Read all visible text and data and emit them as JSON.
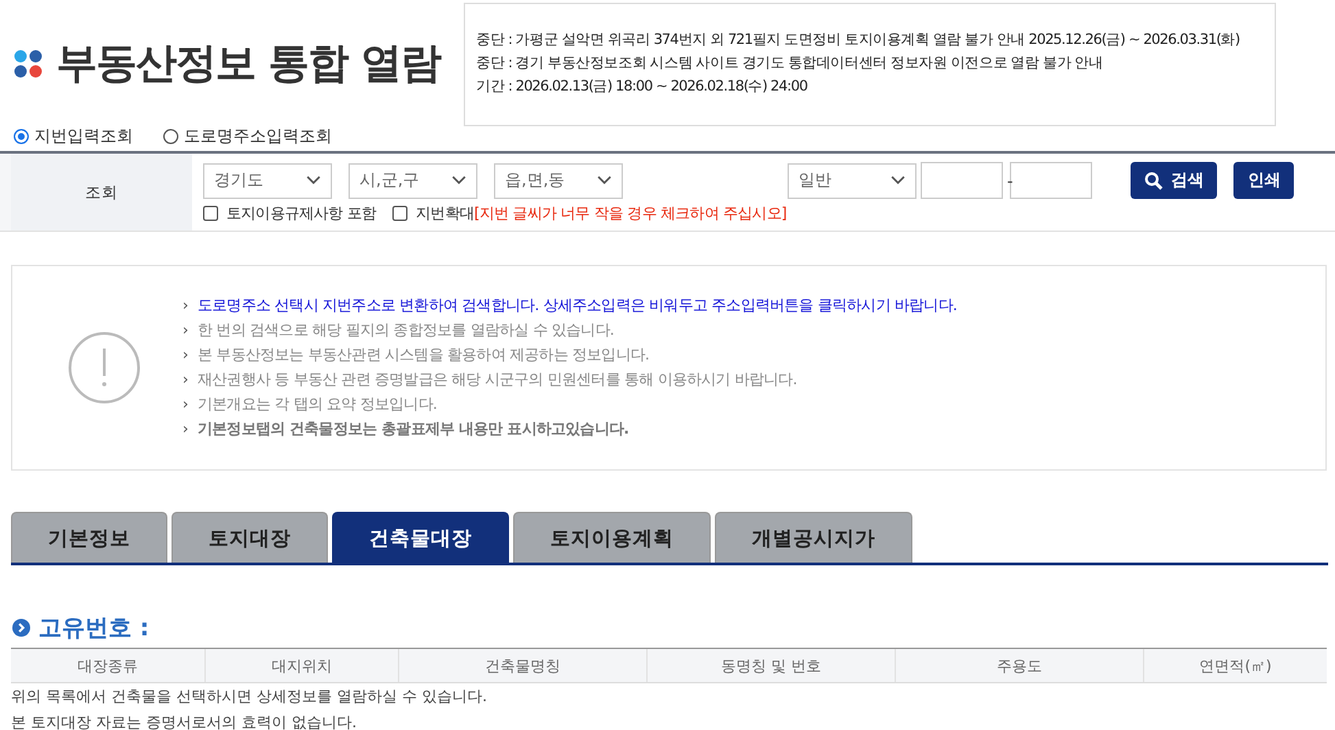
{
  "header": {
    "title": "부동산정보 통합 열람"
  },
  "notices": [
    "중단 : 가평군 설악면 위곡리 374번지 외 721필지 도면정비 토지이용계획 열람 불가 안내 2025.12.26(금) ~ 2026.03.31(화)",
    "중단 : 경기 부동산정보조회 시스템 사이트 경기도 통합데이터센터 정보자원 이전으로 열람 불가 안내",
    "기간 : 2026.02.13(금) 18:00 ~ 2026.02.18(수) 24:00"
  ],
  "input_modes": [
    {
      "label": "지번입력조회",
      "selected": true
    },
    {
      "label": "도로명주소입력조회",
      "selected": false
    }
  ],
  "search": {
    "label": "조회",
    "selects": [
      "경기도",
      "시,군,구",
      "읍,면,동",
      "일반"
    ],
    "separator": "-",
    "options": [
      {
        "label": "토지이용규제사항 포함",
        "checked": false
      },
      {
        "label": "지번확대",
        "checked": false,
        "note": "[지번 글씨가 너무 작을 경우 체크하여 주십시오]"
      }
    ],
    "buttons": [
      {
        "label": "검색",
        "kind": "search"
      },
      {
        "label": "인쇄",
        "kind": "print"
      }
    ]
  },
  "info": [
    {
      "text": "도로명주소 선택시 지번주소로 변환하여 검색합니다. 상세주소입력은 비워두고 주소입력버튼을 클릭하시기 바랍니다.",
      "kind": "highlight"
    },
    {
      "text": "한 번의 검색으로 해당 필지의 종합정보를 열람하실 수 있습니다.",
      "kind": "normal"
    },
    {
      "text": "본 부동산정보는 부동산관련 시스템을 활용하여 제공하는 정보입니다.",
      "kind": "normal"
    },
    {
      "text": "재산권행사 등 부동산 관련 증명발급은 해당 시군구의 민원센터를 통해 이용하시기 바랍니다.",
      "kind": "normal"
    },
    {
      "text": "기본개요는 각 탭의 요약 정보입니다.",
      "kind": "normal"
    },
    {
      "text": "기본정보탭의 건축물정보는 총괄표제부 내용만 표시하고있습니다.",
      "kind": "bold"
    }
  ],
  "info_bullet": "›",
  "tabs": [
    {
      "label": "기본정보",
      "selected": false
    },
    {
      "label": "토지대장",
      "selected": false
    },
    {
      "label": "건축물대장",
      "selected": true
    },
    {
      "label": "토지이용계획",
      "selected": false
    },
    {
      "label": "개별공시지가",
      "selected": false
    }
  ],
  "section": {
    "title": "고유번호 :"
  },
  "table": {
    "columns": [
      "대장종류",
      "대지위치",
      "건축물명칭",
      "동명칭 및 번호",
      "주용도",
      "연면적(㎡)"
    ]
  },
  "footnotes": [
    "위의 목록에서 건축물을 선택하시면 상세정보를 열람하실 수 있습니다.",
    "본 토지대장 자료는 증명서로서의 효력이 없습니다."
  ]
}
